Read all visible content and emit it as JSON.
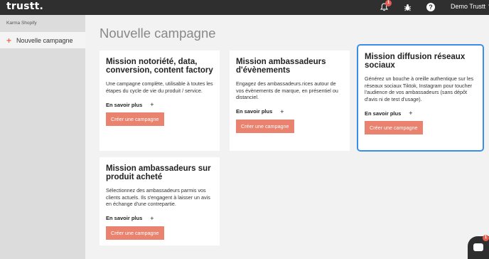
{
  "header": {
    "logo": "trustt.",
    "notifications_count": "1",
    "user_name": "Demo Trustt",
    "icons": [
      "bell-icon",
      "bug-icon",
      "help-icon",
      "chevron-down-icon"
    ]
  },
  "sidebar": {
    "org_name": "Karma Shopify",
    "items": [
      {
        "label": "Nouvelle campagne",
        "icon": "plus-icon"
      }
    ]
  },
  "main": {
    "title": "Nouvelle campagne",
    "cards": [
      {
        "title": "Mission notoriété, data, conversion, content factory",
        "description": "Une campagne complète, utilisable à toutes les étapes du cycle de vie du produit / service.",
        "more_label": "En savoir plus",
        "cta_label": "Créer une campagne"
      },
      {
        "title": "Mission ambassadeurs d'évènements",
        "description": "Engagez des ambassadeurs.rices autour de vos évènements de marque, en présentiel ou distanciel.",
        "more_label": "En savoir plus",
        "cta_label": "Créer une campagne"
      },
      {
        "title": "Mission diffusion réseaux sociaux",
        "description": "Générez un bouche à oreille authentique sur les réseaux sociaux Tiktok, Instagram pour toucher l'audience de vos ambassadeurs (sans dépôt d'avis ni de test d'usage).",
        "more_label": "En savoir plus",
        "cta_label": "Créer une campagne"
      },
      {
        "title": "Mission ambassadeurs sur produit acheté",
        "description": "Sélectionnez des ambassadeurs parmis vos clients actuels. Ils s'engagent à laisser un avis en échange d'une contrepartie.",
        "more_label": "En savoir plus",
        "cta_label": "Créer une campagne"
      }
    ]
  },
  "chat": {
    "badge_count": "1",
    "icon": "chat-icon"
  },
  "colors": {
    "header_bg": "#2f2f2f",
    "accent": "#e9826e",
    "selected_border": "#3b8ee8",
    "badge": "#e85a4f"
  }
}
